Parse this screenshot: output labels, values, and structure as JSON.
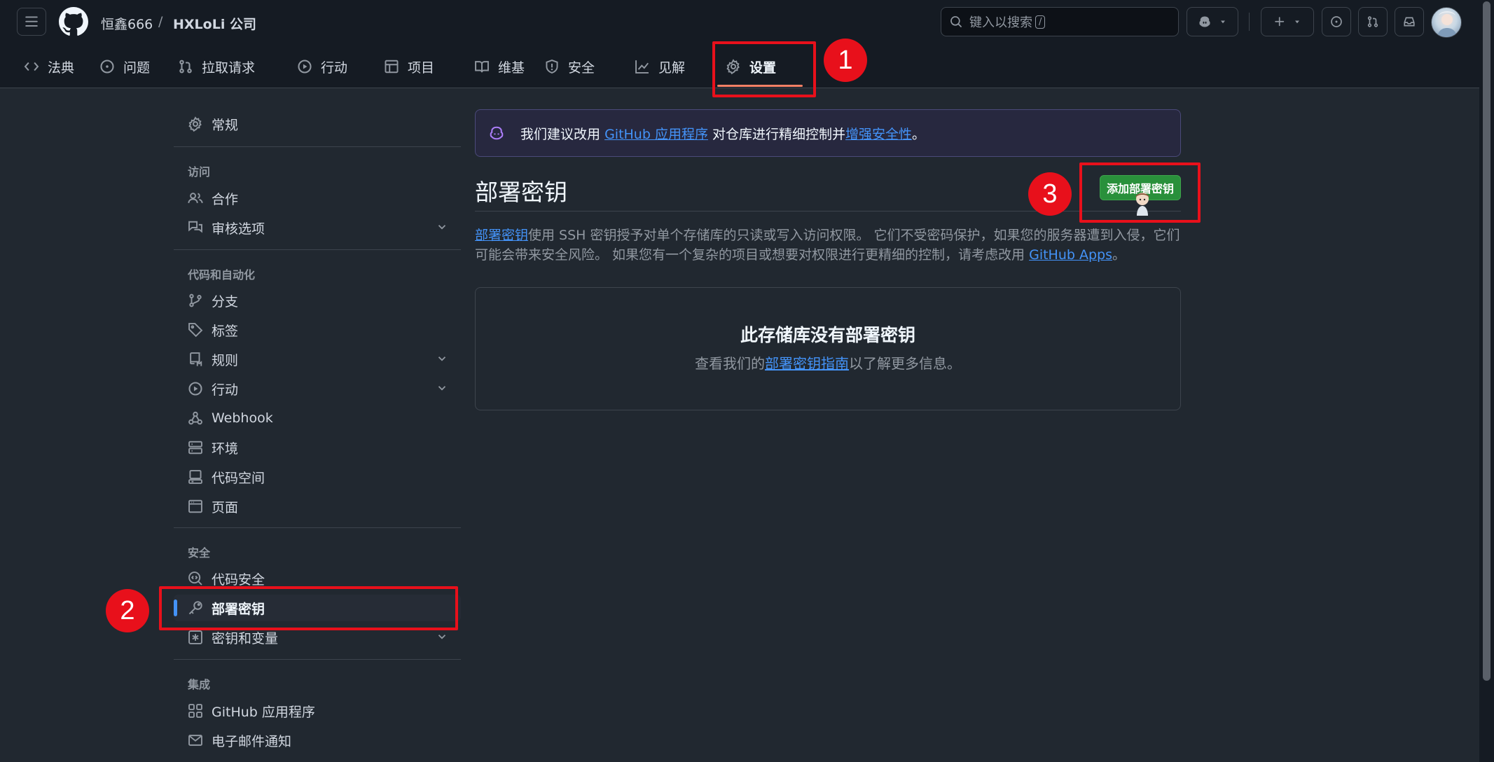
{
  "header": {
    "owner": "恒鑫666",
    "separator": "/",
    "repo": "HXLoLi 公司",
    "search_placeholder": "键入以搜索",
    "search_kbd": "/"
  },
  "tabs": [
    {
      "label": "法典"
    },
    {
      "label": "问题"
    },
    {
      "label": "拉取请求"
    },
    {
      "label": "行动"
    },
    {
      "label": "项目"
    },
    {
      "label": "维基"
    },
    {
      "label": "安全"
    },
    {
      "label": "见解"
    },
    {
      "label": "设置",
      "active": true
    }
  ],
  "sidebar": {
    "general": "常规",
    "sections": {
      "access": "访问",
      "code_automation": "代码和自动化",
      "security": "安全",
      "integrations": "集成"
    },
    "items": {
      "collaborators": "合作",
      "moderation": "审核选项",
      "branches": "分支",
      "tags": "标签",
      "rules": "规则",
      "actions": "行动",
      "webhooks": "Webhook",
      "environments": "环境",
      "codespaces": "代码空间",
      "pages": "页面",
      "code_security": "代码安全",
      "deploy_keys": "部署密钥",
      "secrets": "密钥和变量",
      "github_apps": "GitHub 应用程序",
      "email": "电子邮件通知"
    }
  },
  "banner": {
    "prefix": "我们建议改用",
    "link1": "GitHub 应用程序",
    "middle": "对仓库进行精细控制并",
    "link2": "增强安全性",
    "suffix": "。"
  },
  "main": {
    "title": "部署密钥",
    "add_button": "添加部署密钥",
    "desc_link": "部署密钥",
    "desc_text": "使用 SSH 密钥授予对单个存储库的只读或写入访问权限。 它们不受密码保护，如果您的服务器遭到入侵，它们可能会带来安全风险。 如果您有一个复杂的项目或想要对权限进行更精细的控制，请考虑改用",
    "desc_link2": "GitHub Apps",
    "desc_end": "。",
    "empty_title": "此存储库没有部署密钥",
    "empty_prefix": "查看我们的",
    "empty_link": "部署密钥指南",
    "empty_suffix": "以了解更多信息。"
  },
  "annotations": [
    "1",
    "2",
    "3"
  ],
  "colors": {
    "background": "#212830",
    "header": "#151b23",
    "accent_link": "#4493f8",
    "primary_button": "#29903b",
    "tab_underline": "#f78166",
    "callout": "#e8101b"
  }
}
